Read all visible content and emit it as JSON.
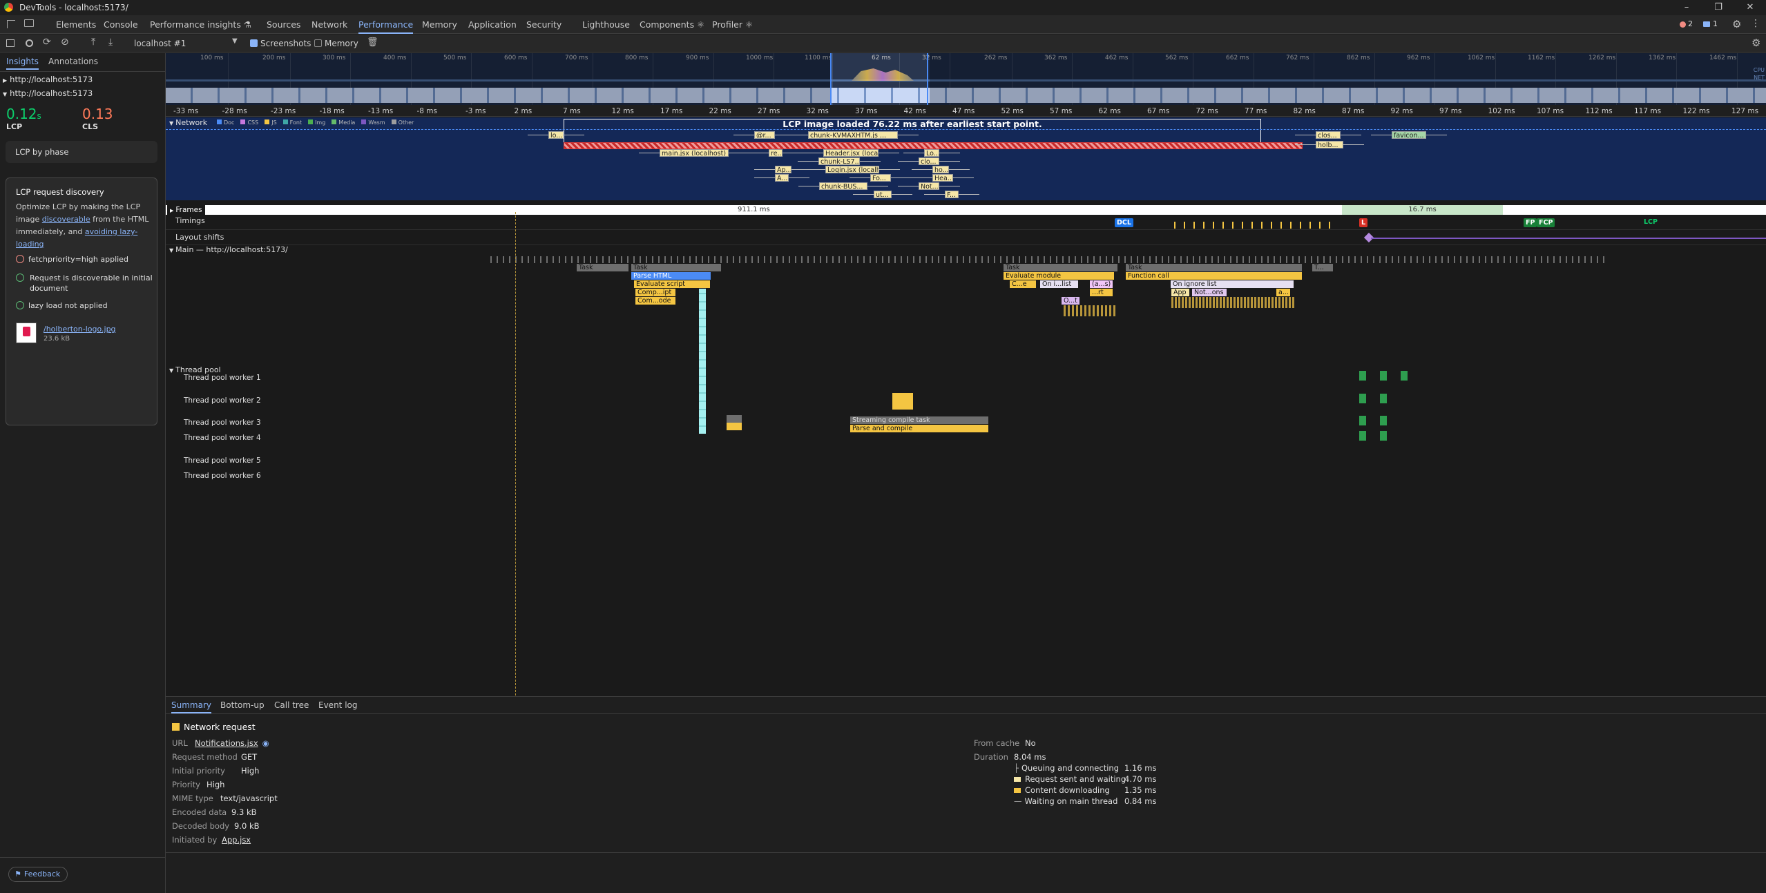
{
  "window": {
    "title": "DevTools - localhost:5173/",
    "minimize": "–",
    "maximize": "❐",
    "close": "✕"
  },
  "tabs": [
    {
      "label": "Elements"
    },
    {
      "label": "Console"
    },
    {
      "label": "Performance insights ⚗"
    },
    {
      "label": "Sources"
    },
    {
      "label": "Network"
    },
    {
      "label": "Performance"
    },
    {
      "label": "Memory"
    },
    {
      "label": "Application"
    },
    {
      "label": "Security"
    },
    {
      "label": "Lighthouse"
    },
    {
      "label": "Components ⚛"
    },
    {
      "label": "Profiler ⚛"
    }
  ],
  "badges": {
    "errors": "2",
    "messages": "1"
  },
  "toolbar": {
    "recording": "localhost #1",
    "screenshots": "Screenshots",
    "memory": "Memory"
  },
  "sidebar": {
    "tabs": [
      "Insights",
      "Annotations"
    ],
    "urls": [
      "http://localhost:5173",
      "http://localhost:5173"
    ],
    "metrics": {
      "lcp_value": "0.12",
      "lcp_unit": "s",
      "lcp_label": "LCP",
      "cls_value": "0.13",
      "cls_label": "CLS"
    },
    "lcp_by_phase": "LCP by phase",
    "discovery": {
      "title": "LCP request discovery",
      "desc_1": "Optimize LCP by making the LCP image ",
      "desc_link1": "discoverable",
      "desc_2": " from the HTML immediately, and ",
      "desc_link2": "avoiding lazy-loading",
      "checks": [
        {
          "label": "fetchpriority=high applied",
          "status": "fail"
        },
        {
          "label": "Request is discoverable in initial document",
          "status": "pass"
        },
        {
          "label": "lazy load not applied",
          "status": "pass"
        }
      ],
      "image_name": "/holberton-logo.jpg",
      "image_size": "23.6 kB"
    },
    "feedback": "Feedback"
  },
  "overview_ticks": [
    "100 ms",
    "200 ms",
    "300 ms",
    "400 ms",
    "500 ms",
    "600 ms",
    "700 ms",
    "800 ms",
    "900 ms",
    "1000 ms",
    "1100 ms",
    "62 ms",
    "32 ms",
    "262 ms",
    "362 ms",
    "462 ms",
    "562 ms",
    "662 ms",
    "762 ms",
    "862 ms",
    "962 ms",
    "1062 ms",
    "1162 ms",
    "1262 ms",
    "1362 ms",
    "1462 ms"
  ],
  "overview_labels": {
    "cpu": "CPU",
    "net": "NET"
  },
  "ruler_ticks": [
    "-33 ms",
    "-28 ms",
    "-23 ms",
    "-18 ms",
    "-13 ms",
    "-8 ms",
    "-3 ms",
    "2 ms",
    "7 ms",
    "12 ms",
    "17 ms",
    "22 ms",
    "27 ms",
    "32 ms",
    "37 ms",
    "42 ms",
    "47 ms",
    "52 ms",
    "57 ms",
    "62 ms",
    "67 ms",
    "72 ms",
    "77 ms",
    "82 ms",
    "87 ms",
    "92 ms",
    "97 ms",
    "102 ms",
    "107 ms",
    "112 ms",
    "117 ms",
    "122 ms",
    "127 ms"
  ],
  "network": {
    "label": "Network",
    "legend": [
      "Doc",
      "CSS",
      "JS",
      "Font",
      "Img",
      "Media",
      "Wasm",
      "Other"
    ],
    "legend_colors": [
      "#4b8bf5",
      "#c678dd",
      "#f4c542",
      "#3fa6a6",
      "#4caf50",
      "#66bb6a",
      "#7e57c2",
      "#9e9e9e"
    ],
    "lcp_banner": "LCP image loaded 76.22 ms after earliest start point.",
    "bars": [
      "lo...",
      "@r...",
      "chunk-KVMAXHTM.js ...",
      "clos...",
      "favicon...",
      "holb...",
      "main.jsx (localhost)",
      "re...",
      "Header.jsx (loca...",
      "Lo...",
      "chunk-LS7...",
      "clo...",
      "Ap...",
      "Login.jsx (localh...",
      "ho...",
      "A...",
      "Fo...",
      "Hea...",
      "chunk-BUS...",
      "Not...",
      "ut...",
      "F..."
    ]
  },
  "frames": {
    "label": "Frames",
    "frame1": "911.1 ms",
    "frame2": "16.7 ms"
  },
  "timings": {
    "label": "Timings",
    "dcl": "DCL",
    "l": "L",
    "fp": "FP",
    "fcp": "FCP",
    "lcp": "LCP"
  },
  "layout_shifts": {
    "label": "Layout shifts"
  },
  "main_track": {
    "label": "Main — http://localhost:5173/",
    "entries": [
      "Task",
      "Task",
      "Parse HTML",
      "Evaluate script",
      "Comp...ipt",
      "Com...ode",
      "Task",
      "Evaluate module",
      "C...e",
      "On i...list",
      "(a...s)",
      "...rt",
      "O...t",
      "Task",
      "Function call",
      "On ignore list",
      "App",
      "Not...ons",
      "a...",
      "T..."
    ]
  },
  "thread_pool": {
    "label": "Thread pool",
    "workers": [
      "Thread pool worker 1",
      "Thread pool worker 2",
      "Thread pool worker 3",
      "Thread pool worker 4",
      "Thread pool worker 5",
      "Thread pool worker 6"
    ],
    "streaming": "Streaming compile task",
    "parse_compile": "Parse and compile"
  },
  "bottom": {
    "tabs": [
      "Summary",
      "Bottom-up",
      "Call tree",
      "Event log"
    ],
    "title": "Network request",
    "fields": [
      {
        "k": "URL",
        "v": "Notifications.jsx"
      },
      {
        "k": "Request method",
        "v": "GET"
      },
      {
        "k": "Initial priority",
        "v": "High"
      },
      {
        "k": "Priority",
        "v": "High"
      },
      {
        "k": "MIME type",
        "v": "text/javascript"
      },
      {
        "k": "Encoded data",
        "v": "9.3 kB"
      },
      {
        "k": "Decoded body",
        "v": "9.0 kB"
      },
      {
        "k": "Initiated by",
        "v": "App.jsx"
      }
    ],
    "from_cache_k": "From cache",
    "from_cache_v": "No",
    "duration_k": "Duration",
    "duration_v": "8.04 ms",
    "phases": [
      {
        "k": "Queuing and connecting",
        "v": "1.16 ms"
      },
      {
        "k": "Request sent and waiting",
        "v": "4.70 ms"
      },
      {
        "k": "Content downloading",
        "v": "1.35 ms"
      },
      {
        "k": "Waiting on main thread",
        "v": "0.84 ms"
      }
    ]
  },
  "colors": {
    "accent": "#8ab4f8",
    "lcp_green": "#0cce6b",
    "cls_red": "#ff7a59",
    "script_yellow": "#f4c542",
    "task_gray": "#6e6e6e",
    "render_purple": "#b58ae0"
  }
}
